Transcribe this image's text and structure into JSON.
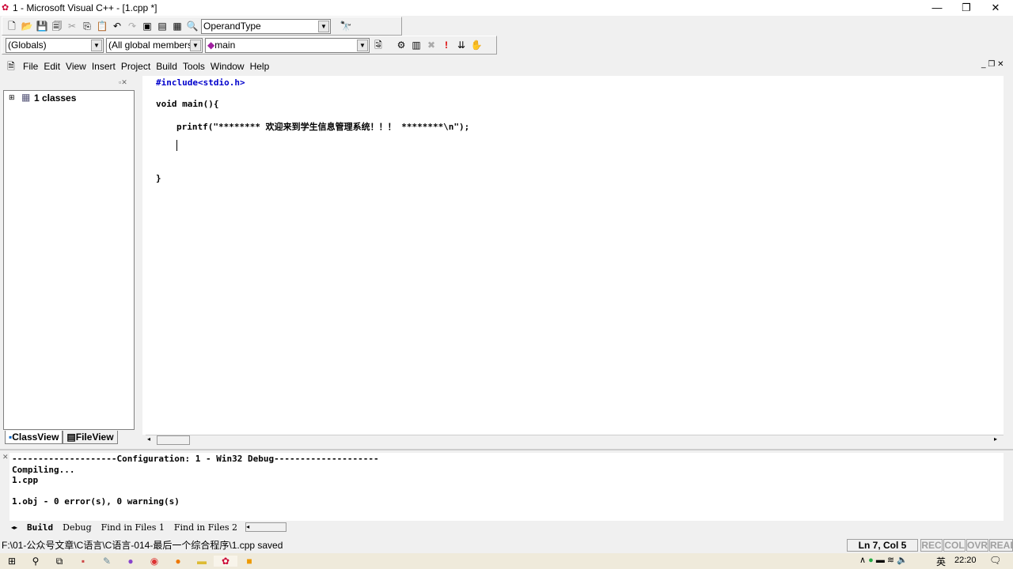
{
  "window": {
    "title": "1 - Microsoft Visual C++ - [1.cpp *]"
  },
  "toolbar": {
    "find_combo": "OperandType",
    "scope_combo": "(Globals)",
    "members_combo": "(All global members",
    "function_combo": "main"
  },
  "menu": [
    "File",
    "Edit",
    "View",
    "Insert",
    "Project",
    "Build",
    "Tools",
    "Window",
    "Help"
  ],
  "workspace": {
    "tree_root": "1 classes",
    "tabs": [
      "ClassView",
      "FileView"
    ]
  },
  "editor": {
    "lines": [
      "#include<stdio.h>",
      "void main(){",
      "printf(\"******** 欢迎来到学生信息管理系统！！！ ********\\n\");",
      "",
      "}"
    ]
  },
  "output": {
    "lines": [
      "--------------------Configuration: 1 - Win32 Debug--------------------",
      "Compiling...",
      "1.cpp",
      "",
      "1.obj - 0 error(s), 0 warning(s)"
    ],
    "tabs": [
      "Build",
      "Debug",
      "Find in Files 1",
      "Find in Files 2"
    ]
  },
  "status": {
    "message": "F:\\01-公众号文章\\C语言\\C语言-014-最后一个综合程序\\1.cpp saved",
    "position": "Ln 7, Col 5",
    "indicators": [
      "REC",
      "COL",
      "OVR",
      "READ"
    ]
  },
  "taskbar": {
    "time": "22:20",
    "ime": "英"
  }
}
